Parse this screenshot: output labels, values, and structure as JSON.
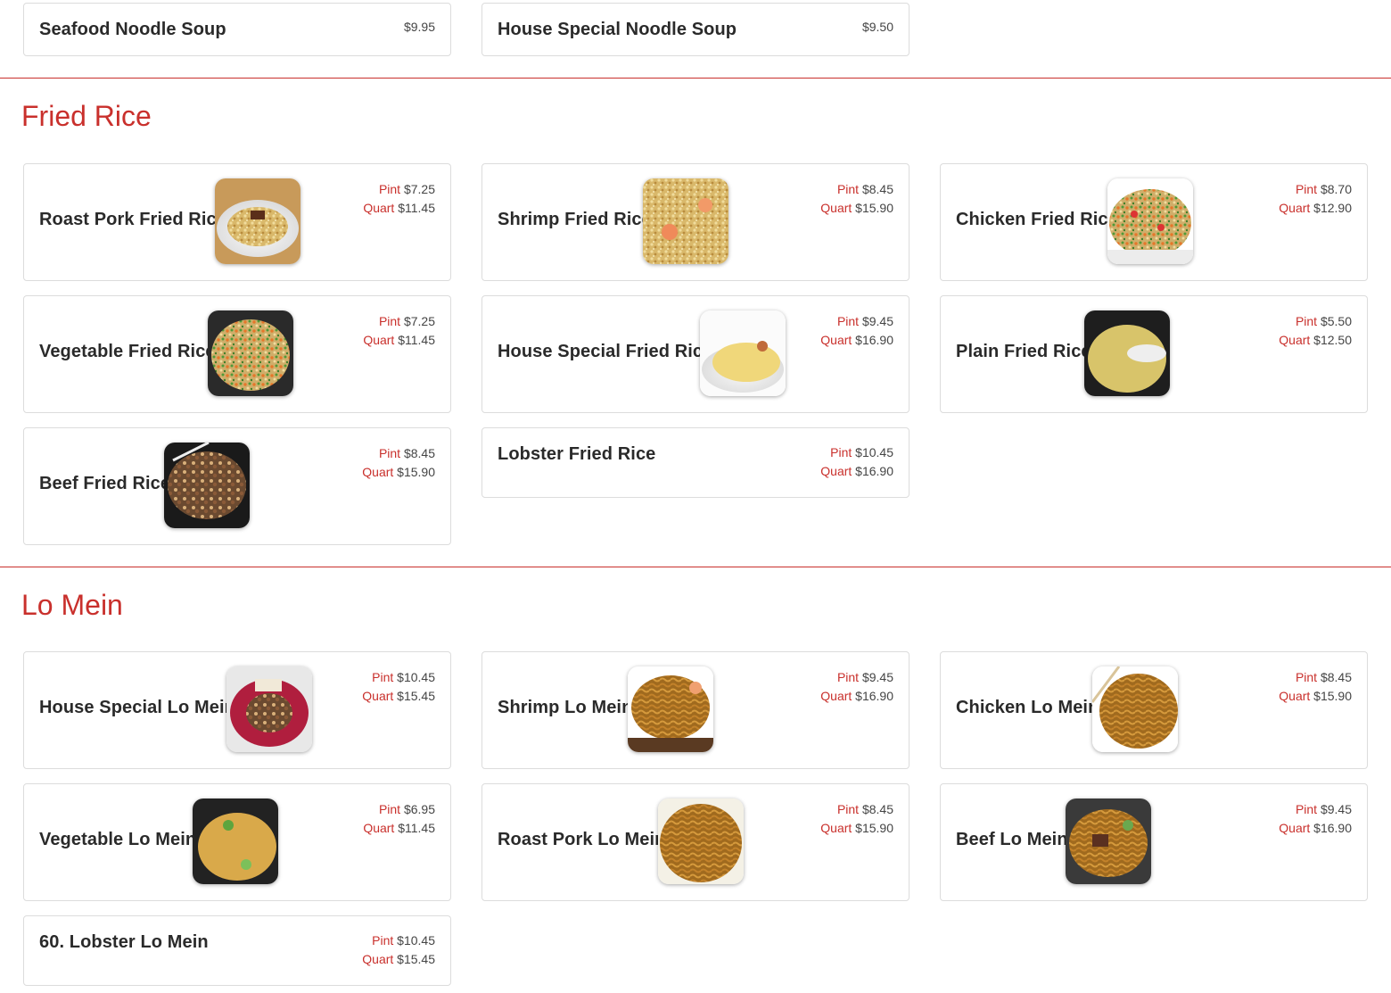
{
  "colors": {
    "accent": "#c9302c",
    "border": "#dcdcdc",
    "text": "#2a2a2a"
  },
  "soups": [
    {
      "name": "Seafood Noodle Soup",
      "price": "$9.95"
    },
    {
      "name": "House Special Noodle Soup",
      "price": "$9.50"
    }
  ],
  "fried_rice": {
    "title": "Fried Rice",
    "items": [
      {
        "name": "Roast Pork Fried Rice",
        "pint_label": "Pint",
        "pint": "$7.25",
        "quart_label": "Quart",
        "quart": "$11.45",
        "image": "roast-pork-fried-rice-photo"
      },
      {
        "name": "Shrimp Fried Rice",
        "pint_label": "Pint",
        "pint": "$8.45",
        "quart_label": "Quart",
        "quart": "$15.90",
        "image": "shrimp-fried-rice-photo"
      },
      {
        "name": "Chicken Fried Rice",
        "pint_label": "Pint",
        "pint": "$8.70",
        "quart_label": "Quart",
        "quart": "$12.90",
        "image": "chicken-fried-rice-photo"
      },
      {
        "name": "Vegetable Fried Rice",
        "pint_label": "Pint",
        "pint": "$7.25",
        "quart_label": "Quart",
        "quart": "$11.45",
        "image": "vegetable-fried-rice-photo"
      },
      {
        "name": "House Special Fried Rice",
        "pint_label": "Pint",
        "pint": "$9.45",
        "quart_label": "Quart",
        "quart": "$16.90",
        "image": "house-special-fried-rice-photo"
      },
      {
        "name": "Plain Fried Rice",
        "pint_label": "Pint",
        "pint": "$5.50",
        "quart_label": "Quart",
        "quart": "$12.50",
        "image": "plain-fried-rice-photo"
      },
      {
        "name": "Beef Fried Rice",
        "pint_label": "Pint",
        "pint": "$8.45",
        "quart_label": "Quart",
        "quart": "$15.90",
        "image": "beef-fried-rice-photo"
      },
      {
        "name": "Lobster Fried Rice",
        "pint_label": "Pint",
        "pint": "$10.45",
        "quart_label": "Quart",
        "quart": "$16.90"
      }
    ]
  },
  "lo_mein": {
    "title": "Lo Mein",
    "items": [
      {
        "name": "House Special Lo Mein",
        "pint_label": "Pint",
        "pint": "$10.45",
        "quart_label": "Quart",
        "quart": "$15.45",
        "image": "house-special-lo-mein-photo"
      },
      {
        "name": "Shrimp Lo Mein",
        "pint_label": "Pint",
        "pint": "$9.45",
        "quart_label": "Quart",
        "quart": "$16.90",
        "image": "shrimp-lo-mein-photo"
      },
      {
        "name": "Chicken Lo Mein",
        "pint_label": "Pint",
        "pint": "$8.45",
        "quart_label": "Quart",
        "quart": "$15.90",
        "image": "chicken-lo-mein-photo"
      },
      {
        "name": "Vegetable Lo Mein",
        "pint_label": "Pint",
        "pint": "$6.95",
        "quart_label": "Quart",
        "quart": "$11.45",
        "image": "vegetable-lo-mein-photo"
      },
      {
        "name": "Roast Pork Lo Mein",
        "pint_label": "Pint",
        "pint": "$8.45",
        "quart_label": "Quart",
        "quart": "$15.90",
        "image": "roast-pork-lo-mein-photo"
      },
      {
        "name": "Beef Lo Mein",
        "pint_label": "Pint",
        "pint": "$9.45",
        "quart_label": "Quart",
        "quart": "$16.90",
        "image": "beef-lo-mein-photo"
      },
      {
        "name": "60. Lobster Lo Mein",
        "pint_label": "Pint",
        "pint": "$10.45",
        "quart_label": "Quart",
        "quart": "$15.45"
      }
    ]
  }
}
